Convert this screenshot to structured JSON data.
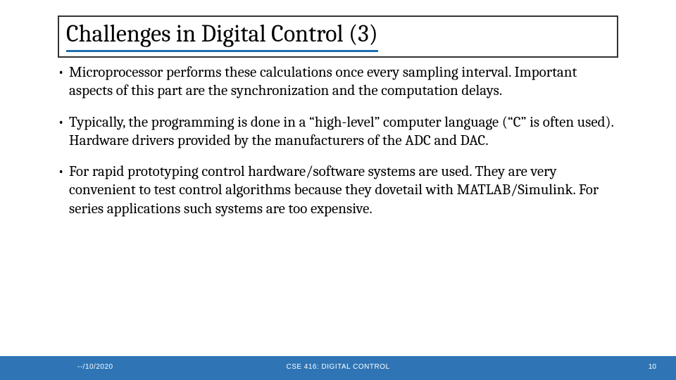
{
  "title": "Challenges in Digital Control (3)",
  "bullets": [
    "Microprocessor performs these calculations once every sampling interval. Important aspects of this part are the synchronization and the computation delays.",
    "Typically, the programming is done in a “high-level” computer language (“C” is often used). Hardware drivers provided by the manufacturers of the ADC and DAC.",
    "For rapid prototyping control hardware/software systems are used. They are very convenient to test control algorithms because they dovetail with MATLAB/Simulink. For series applications such systems are too expensive."
  ],
  "footer": {
    "date": "--/10/2020",
    "course": "CSE 416: DIGITAL CONTROL",
    "page": "10"
  }
}
